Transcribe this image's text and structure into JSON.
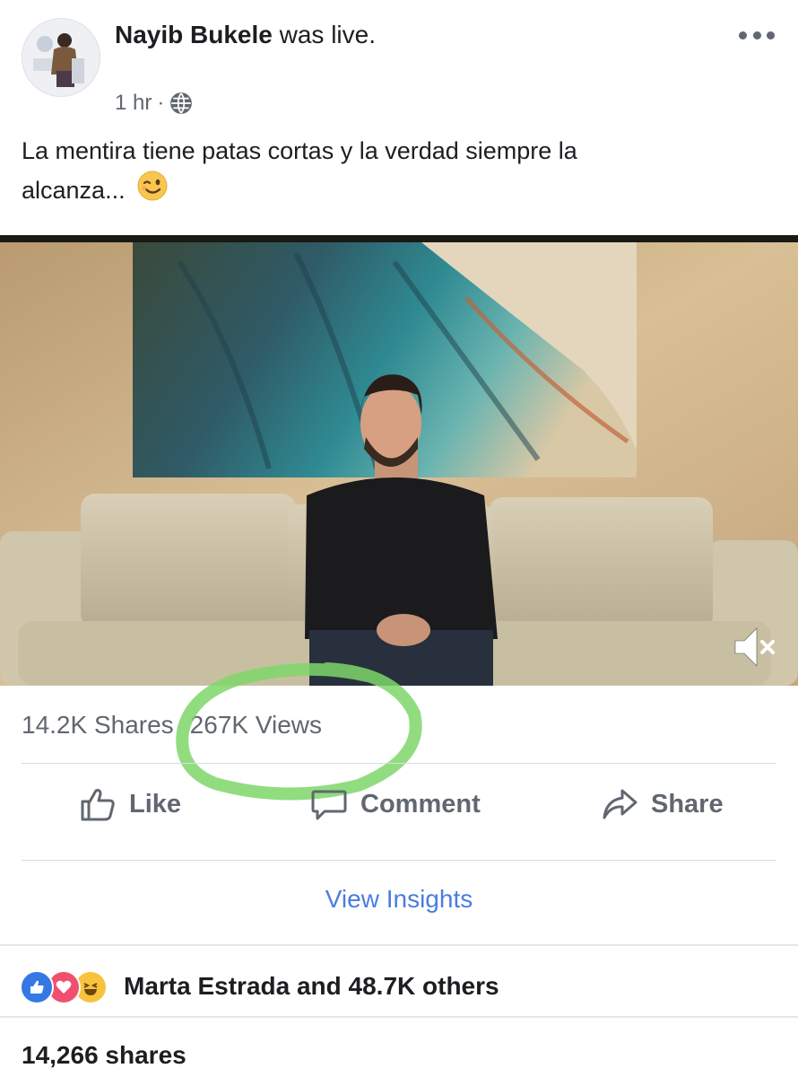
{
  "post": {
    "author_name": "Nayib Bukele",
    "author_action": "was live.",
    "time": "1 hr",
    "dot": "·",
    "caption_line1": "La mentira tiene patas cortas y la verdad siempre la",
    "caption_line2": "alcanza..."
  },
  "stats": {
    "shares": "14.2K Shares",
    "views": "267K Views"
  },
  "actions": {
    "like": "Like",
    "comment": "Comment",
    "share": "Share"
  },
  "insights_label": "View Insights",
  "reactions_summary": "Marta Estrada and 48.7K others",
  "total_shares": "14,266 shares",
  "colors": {
    "link_blue": "#4a7de2",
    "like_blue": "#3578e5",
    "love_red": "#f0506e",
    "haha_yellow": "#f7c33d",
    "highlight_green": "#7fd66a"
  }
}
